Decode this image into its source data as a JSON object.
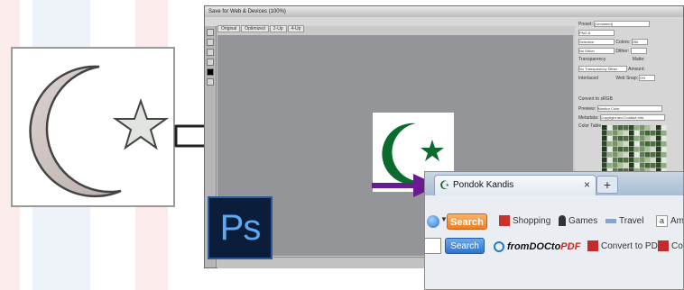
{
  "colors": {
    "accent_purple": "#6a1b8f",
    "crescent_green": "#0b6b2e",
    "ps_blue": "#5ea7f2"
  },
  "photoshop": {
    "window_title": "Save for Web & Devices (100%)",
    "tabs": [
      "Original",
      "Optimized",
      "2-Up",
      "4-Up"
    ],
    "logo_text": "Ps",
    "panel": {
      "preset_label": "Preset:",
      "preset_value": "[Unnamed]",
      "format_value": "PNG-8",
      "reduction_value": "Selective",
      "colors_label": "Colors:",
      "colors_value": "256",
      "dither_value": "No Dither",
      "dither_label": "Dither:",
      "transparency_label": "Transparency",
      "matte_label": "Matte:",
      "trans_dither_value": "No Transparency Dither",
      "amount_label": "Amount:",
      "interlaced_label": "Interlaced",
      "websnap_label": "Web Snap:",
      "websnap_value": "0%",
      "convert_srgb_label": "Convert to sRGB",
      "preview_label": "Preview:",
      "preview_value": "Monitor Color",
      "metadata_label": "Metadata:",
      "metadata_value": "Copyright and Contact Info",
      "color_table_label": "Color Table"
    }
  },
  "firefox": {
    "tab_title": "Pondok Kandis",
    "tab_close": "×",
    "new_tab": "+",
    "toolbar1": {
      "search_button": "Search",
      "shopping": "Shopping",
      "games": "Games",
      "travel": "Travel",
      "amazon": "Am"
    },
    "toolbar2": {
      "search_button": "Search",
      "fromdoc_prefix": "from",
      "fromdoc_mid": "DOC",
      "fromdoc_to": "to",
      "fromdoc_suffix": "PDF",
      "convert": "Convert to PDF",
      "cut": "Co"
    }
  }
}
